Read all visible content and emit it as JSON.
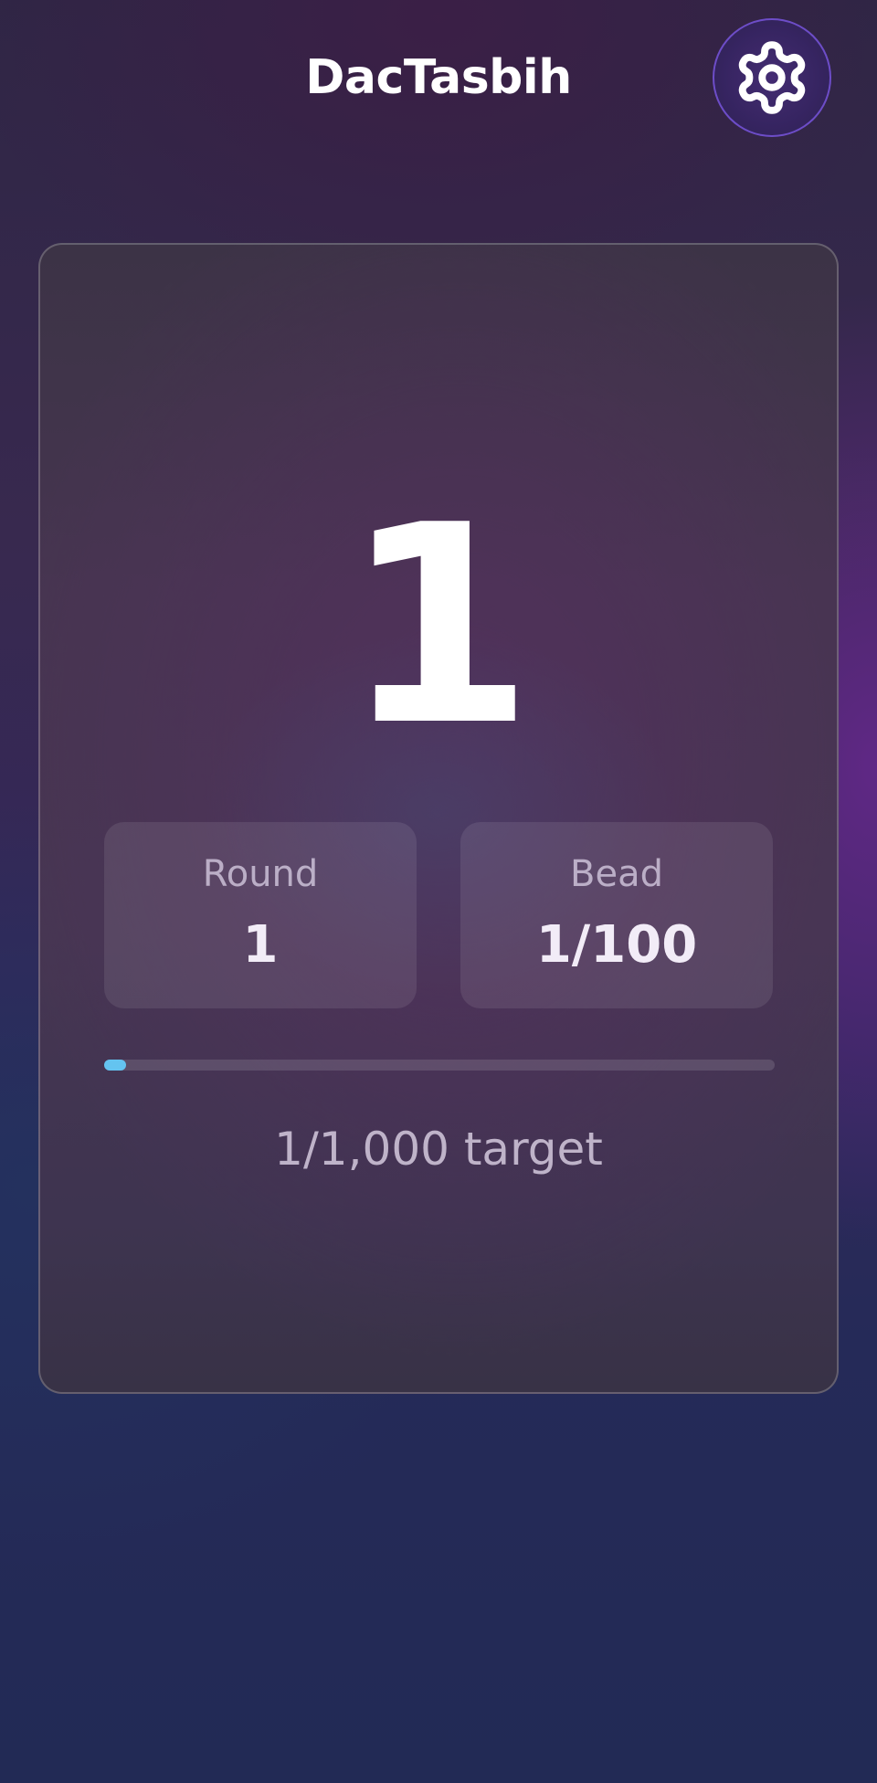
{
  "app": {
    "title": "DacTasbih"
  },
  "header": {
    "settings_icon": "gear-icon"
  },
  "counter": {
    "count": "1",
    "round": {
      "label": "Round",
      "value": "1"
    },
    "bead": {
      "label": "Bead",
      "value": "1/100"
    },
    "progress": {
      "value": 1,
      "max": 1000,
      "color": "#64c4f0"
    },
    "target_text": "1/1,000 target"
  },
  "colors": {
    "accent": "#64c4f0",
    "settings_ring": "#7855dc",
    "background_top": "#2f2645",
    "background_bottom": "#222a55"
  }
}
